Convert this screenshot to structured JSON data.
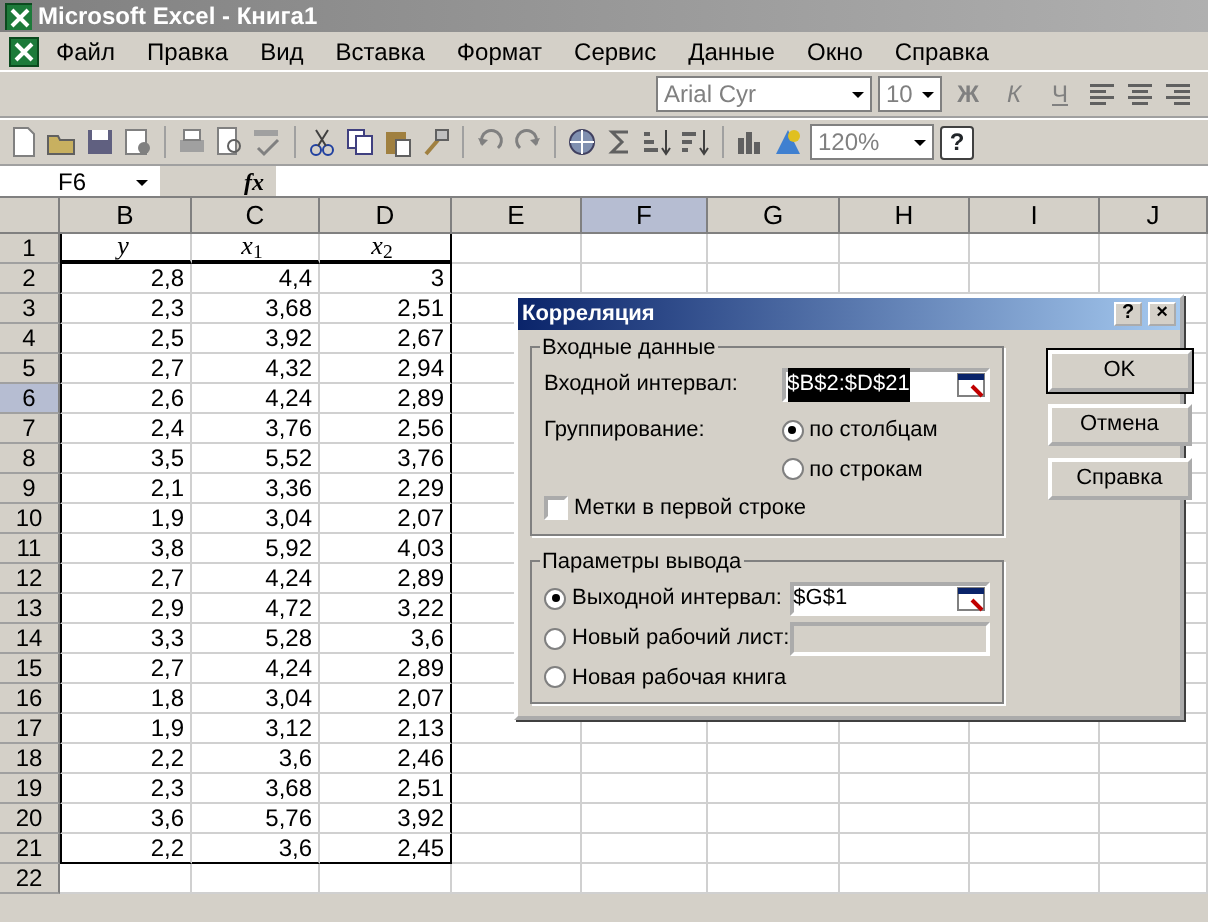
{
  "window": {
    "title": "Microsoft Excel - Книга1"
  },
  "menu": [
    "Файл",
    "Правка",
    "Вид",
    "Вставка",
    "Формат",
    "Сервис",
    "Данные",
    "Окно",
    "Справка"
  ],
  "format_toolbar": {
    "font": "Arial Cyr",
    "size": "10",
    "buttons": [
      {
        "label": "Ж",
        "kind": "bold"
      },
      {
        "label": "К",
        "kind": "italic"
      },
      {
        "label": "Ч",
        "kind": "underline"
      }
    ]
  },
  "standard_toolbar": {
    "zoom": "120%",
    "help": "?"
  },
  "formula_bar": {
    "name_box": "F6",
    "fx": "fx"
  },
  "columns": [
    {
      "label": "B",
      "selected": false
    },
    {
      "label": "C",
      "selected": false
    },
    {
      "label": "D",
      "selected": false
    },
    {
      "label": "E",
      "selected": false
    },
    {
      "label": "F",
      "selected": true
    },
    {
      "label": "G",
      "selected": false
    },
    {
      "label": "H",
      "selected": false
    },
    {
      "label": "I",
      "selected": false
    },
    {
      "label": "J",
      "selected": false
    }
  ],
  "rows": [
    {
      "number": "1",
      "selected": false,
      "cells": [
        "*y*",
        "*x*$_{1}$",
        "*x*$_{2}$"
      ]
    },
    {
      "number": "2",
      "selected": false,
      "cells": [
        "2,8",
        "4,4",
        "3"
      ]
    },
    {
      "number": "3",
      "selected": false,
      "cells": [
        "2,3",
        "3,68",
        "2,51"
      ]
    },
    {
      "number": "4",
      "selected": false,
      "cells": [
        "2,5",
        "3,92",
        "2,67"
      ]
    },
    {
      "number": "5",
      "selected": false,
      "cells": [
        "2,7",
        "4,32",
        "2,94"
      ]
    },
    {
      "number": "6",
      "selected": true,
      "cells": [
        "2,6",
        "4,24",
        "2,89"
      ]
    },
    {
      "number": "7",
      "selected": false,
      "cells": [
        "2,4",
        "3,76",
        "2,56"
      ]
    },
    {
      "number": "8",
      "selected": false,
      "cells": [
        "3,5",
        "5,52",
        "3,76"
      ]
    },
    {
      "number": "9",
      "selected": false,
      "cells": [
        "2,1",
        "3,36",
        "2,29"
      ]
    },
    {
      "number": "10",
      "selected": false,
      "cells": [
        "1,9",
        "3,04",
        "2,07"
      ]
    },
    {
      "number": "11",
      "selected": false,
      "cells": [
        "3,8",
        "5,92",
        "4,03"
      ]
    },
    {
      "number": "12",
      "selected": false,
      "cells": [
        "2,7",
        "4,24",
        "2,89"
      ]
    },
    {
      "number": "13",
      "selected": false,
      "cells": [
        "2,9",
        "4,72",
        "3,22"
      ]
    },
    {
      "number": "14",
      "selected": false,
      "cells": [
        "3,3",
        "5,28",
        "3,6"
      ]
    },
    {
      "number": "15",
      "selected": false,
      "cells": [
        "2,7",
        "4,24",
        "2,89"
      ]
    },
    {
      "number": "16",
      "selected": false,
      "cells": [
        "1,8",
        "3,04",
        "2,07"
      ]
    },
    {
      "number": "17",
      "selected": false,
      "cells": [
        "1,9",
        "3,12",
        "2,13"
      ]
    },
    {
      "number": "18",
      "selected": false,
      "cells": [
        "2,2",
        "3,6",
        "2,46"
      ]
    },
    {
      "number": "19",
      "selected": false,
      "cells": [
        "2,3",
        "3,68",
        "2,51"
      ]
    },
    {
      "number": "20",
      "selected": false,
      "cells": [
        "3,6",
        "5,76",
        "3,92"
      ]
    },
    {
      "number": "21",
      "selected": false,
      "cells": [
        "2,2",
        "3,6",
        "2,45"
      ]
    },
    {
      "number": "22",
      "selected": false,
      "cells": []
    }
  ],
  "dialog": {
    "title": "Корреляция",
    "help": "?",
    "close": "×",
    "input_group": {
      "legend": "Входные данные",
      "range_label": "Входной интервал:",
      "range_value": "$B$2:$D$21",
      "grouping_label": "Группирование:",
      "grouping": [
        {
          "label": "по столбцам",
          "selected": true
        },
        {
          "label": "по строкам",
          "selected": false
        }
      ],
      "labels_checkbox": {
        "label": "Метки в первой строке",
        "checked": false
      }
    },
    "output_group": {
      "legend": "Параметры вывода",
      "options": [
        {
          "label": "Выходной интервал:",
          "selected": true,
          "field": true,
          "value": "$G$1"
        },
        {
          "label": "Новый рабочий лист:",
          "selected": false,
          "field": true
        },
        {
          "label": "Новая рабочая книга",
          "selected": false
        }
      ]
    },
    "buttons": [
      "OK",
      "Отмена",
      "Справка"
    ]
  }
}
